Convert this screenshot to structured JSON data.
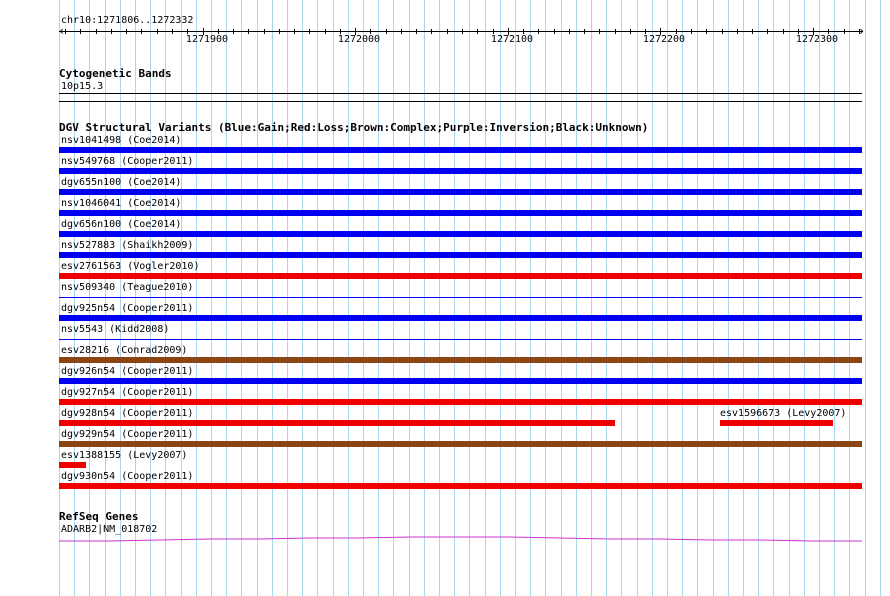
{
  "ruler": {
    "position_label": "chr10:1271806..1272332",
    "range": [
      1271806,
      1272332
    ],
    "ticks": [
      "1271900",
      "1272000",
      "1272100",
      "1272200",
      "1272300"
    ]
  },
  "cytoband": {
    "title": "Cytogenetic Bands",
    "band": "10p15.3"
  },
  "dgv": {
    "title": "DGV Structural Variants (Blue:Gain;Red:Loss;Brown:Complex;Purple:Inversion;Black:Unknown)",
    "colors": {
      "gain": "#0000ee",
      "loss": "#ee0000",
      "complex": "#8b4513"
    },
    "variants": [
      {
        "label": "nsv1041498 (Coe2014)",
        "type": "gain",
        "span": [
          1271806,
          1272332
        ]
      },
      {
        "label": "nsv549768 (Cooper2011)",
        "type": "gain",
        "span": [
          1271806,
          1272332
        ]
      },
      {
        "label": "dgv655n100 (Coe2014)",
        "type": "gain",
        "span": [
          1271806,
          1272332
        ]
      },
      {
        "label": "nsv1046041 (Coe2014)",
        "type": "gain",
        "span": [
          1271806,
          1272332
        ]
      },
      {
        "label": "dgv656n100 (Coe2014)",
        "type": "gain",
        "span": [
          1271806,
          1272332
        ]
      },
      {
        "label": "nsv527883 (Shaikh2009)",
        "type": "gain",
        "span": [
          1271806,
          1272332
        ]
      },
      {
        "label": "esv2761563 (Vogler2010)",
        "type": "loss",
        "span": [
          1271806,
          1272332
        ]
      },
      {
        "label": "nsv509340 (Teague2010)",
        "type": "gain",
        "span": [
          1271806,
          1272332
        ],
        "thin": true
      },
      {
        "label": "dgv925n54 (Cooper2011)",
        "type": "gain",
        "span": [
          1271806,
          1272332
        ]
      },
      {
        "label": "nsv5543 (Kidd2008)",
        "type": "gain",
        "span": [
          1271806,
          1272332
        ],
        "thin": true
      },
      {
        "label": "esv28216 (Conrad2009)",
        "type": "complex",
        "span": [
          1271806,
          1272332
        ]
      },
      {
        "label": "dgv926n54 (Cooper2011)",
        "type": "gain",
        "span": [
          1271806,
          1272332
        ]
      },
      {
        "label": "dgv927n54 (Cooper2011)",
        "type": "loss",
        "span": [
          1271806,
          1272332
        ]
      },
      {
        "label": "dgv928n54 (Cooper2011)",
        "type": "loss",
        "span": [
          1271806,
          1272170
        ],
        "extra": {
          "label": "esv1596673 (Levy2007)",
          "type": "loss",
          "span": [
            1272239,
            1272313
          ]
        }
      },
      {
        "label": "dgv929n54 (Cooper2011)",
        "type": "complex",
        "span": [
          1271806,
          1272332
        ]
      },
      {
        "label": "esv1388155 (Levy2007)",
        "type": "loss",
        "span": [
          1271806,
          1271824
        ]
      },
      {
        "label": "dgv930n54 (Cooper2011)",
        "type": "loss",
        "span": [
          1271806,
          1272332
        ]
      }
    ]
  },
  "refseq": {
    "title": "RefSeq Genes",
    "gene": "ADARB2|NM_018702",
    "line_color": "#cc33cc"
  },
  "grid_color": "#a8d8f0"
}
